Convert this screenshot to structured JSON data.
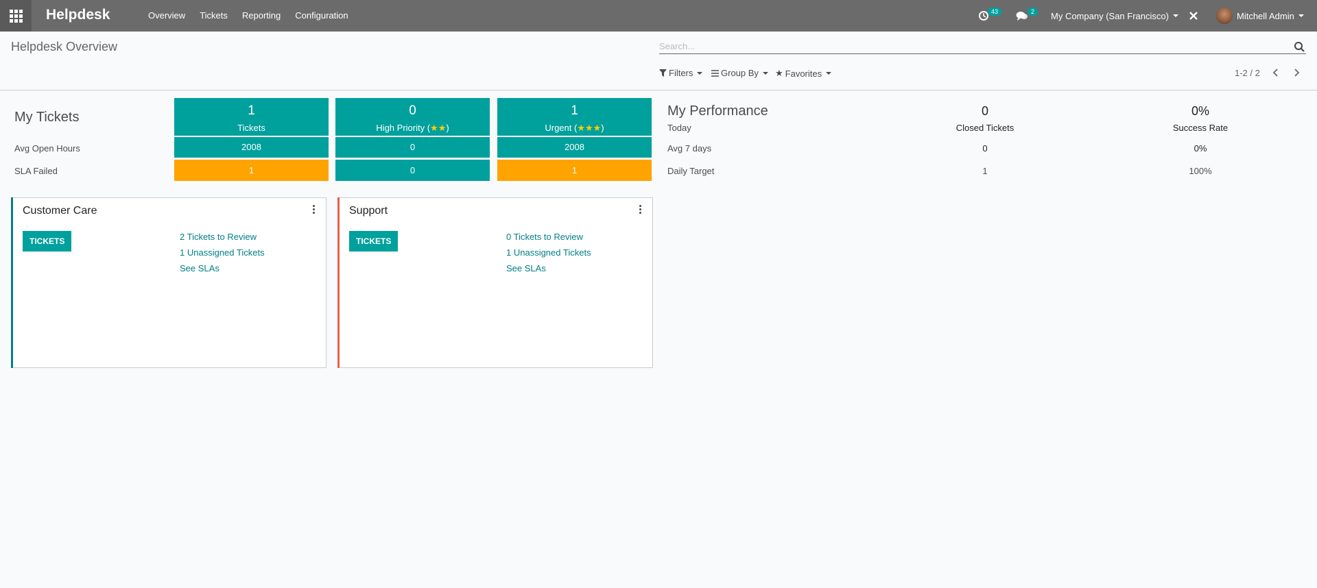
{
  "navbar": {
    "app_title": "Helpdesk",
    "menu": [
      "Overview",
      "Tickets",
      "Reporting",
      "Configuration"
    ],
    "activity_count": "43",
    "message_count": "2",
    "company": "My Company (San Francisco)",
    "user": "Mitchell Admin"
  },
  "control_panel": {
    "title": "Helpdesk Overview",
    "search_placeholder": "Search...",
    "filters": "Filters",
    "group_by": "Group By",
    "favorites": "Favorites",
    "pager": "1-2 / 2"
  },
  "my_tickets": {
    "title": "My Tickets",
    "row_labels": [
      "Avg Open Hours",
      "SLA Failed"
    ],
    "tiles": [
      {
        "value": "1",
        "label": "Tickets",
        "stars": "",
        "avg_hours": "2008",
        "sla_failed": "1"
      },
      {
        "value": "0",
        "label": "High Priority (",
        "stars": "★★",
        "avg_hours": "0",
        "sla_failed": "0"
      },
      {
        "value": "1",
        "label": "Urgent (",
        "stars": "★★★",
        "avg_hours": "2008",
        "sla_failed": "1"
      }
    ]
  },
  "my_performance": {
    "title": "My Performance",
    "rows": [
      "Today",
      "Avg 7 days",
      "Daily Target"
    ],
    "closed": {
      "today": "0",
      "label": "Closed Tickets",
      "avg7": "0",
      "target": "1"
    },
    "success": {
      "today": "0%",
      "label": "Success Rate",
      "avg7": "0%",
      "target": "100%"
    }
  },
  "teams": [
    {
      "name": "Customer Care",
      "button": "TICKETS",
      "links": [
        "2 Tickets to Review",
        "1 Unassigned Tickets",
        "See SLAs"
      ],
      "color": "#017e84"
    },
    {
      "name": "Support",
      "button": "TICKETS",
      "links": [
        "0 Tickets to Review",
        "1 Unassigned Tickets",
        "See SLAs"
      ],
      "color": "#e8604c"
    }
  ],
  "colors": {
    "teal": "#00a09d",
    "orange": "#ffa300",
    "navbar": "#6b6b6b"
  }
}
